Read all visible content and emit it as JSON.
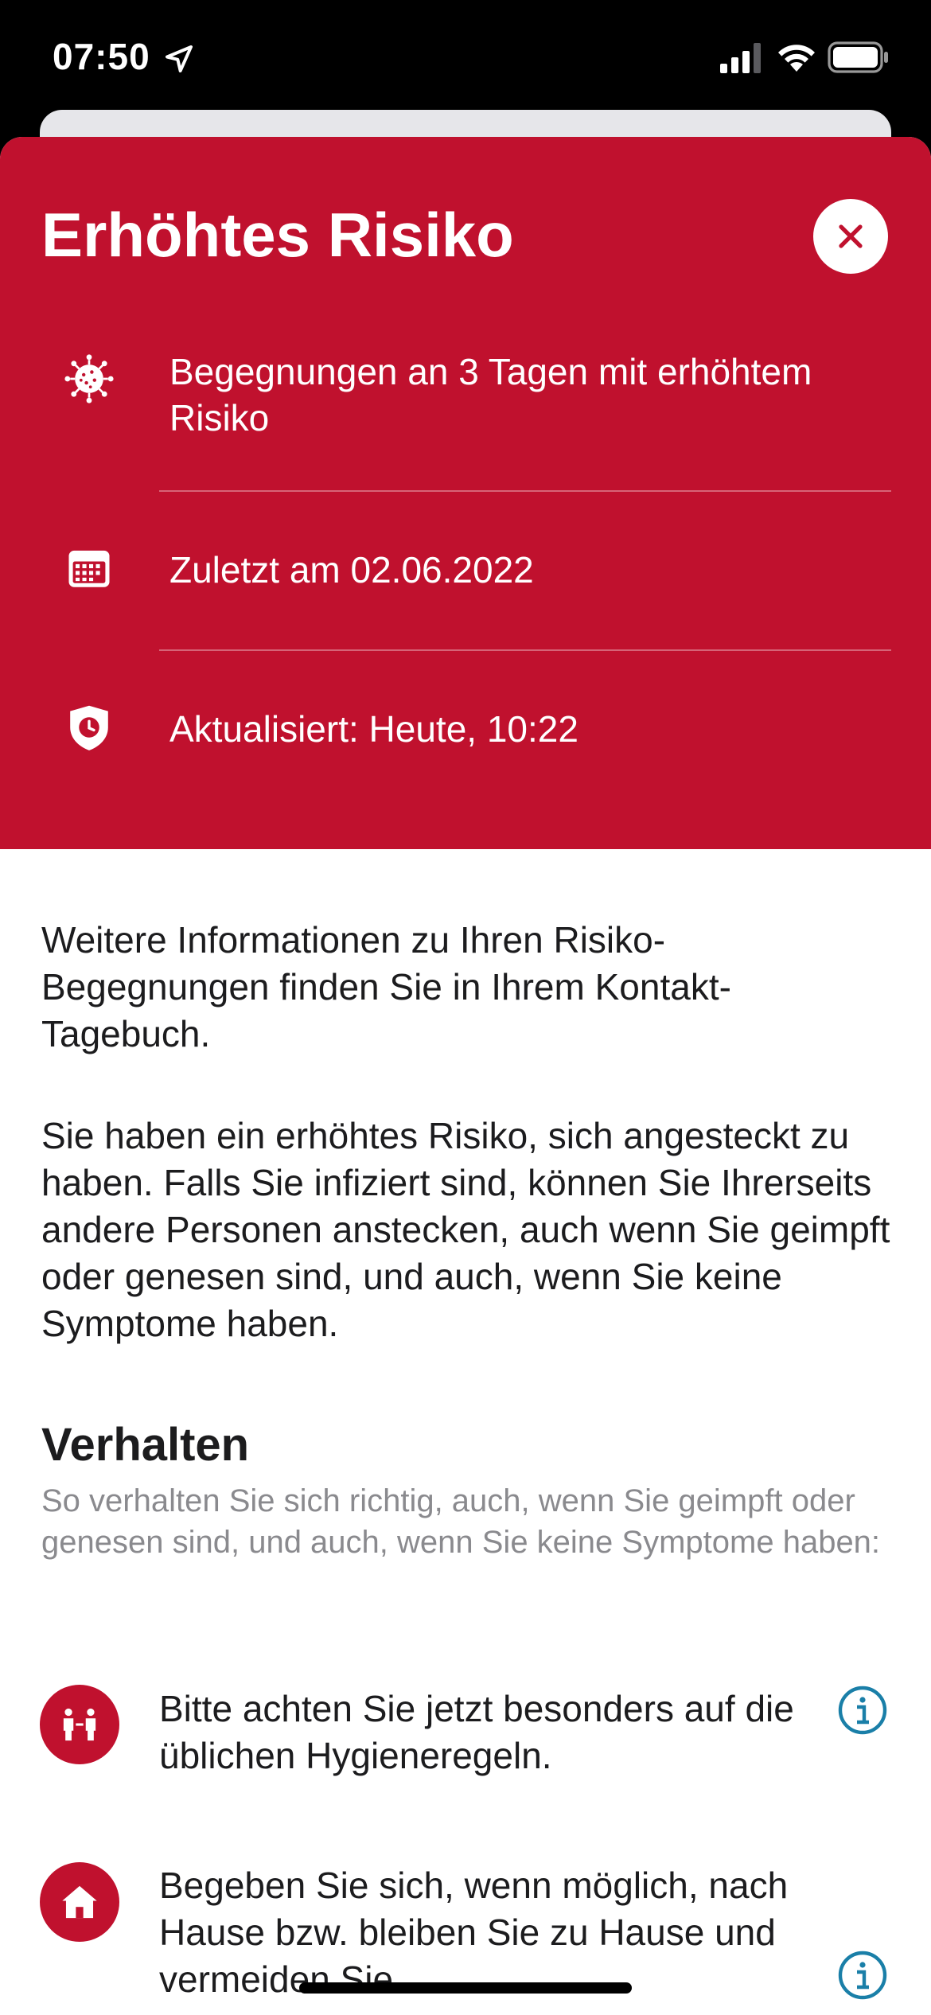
{
  "status_bar": {
    "time": "07:50"
  },
  "risk_card": {
    "title": "Erhöhtes Risiko",
    "color": "#c0112e",
    "rows": [
      {
        "icon": "virus-icon",
        "text": "Begegnungen an 3 Tagen mit erhöhtem Risiko"
      },
      {
        "icon": "calendar-icon",
        "text": "Zuletzt am 02.06.2022"
      },
      {
        "icon": "shield-clock-icon",
        "text": "Aktualisiert: Heute, 10:22"
      }
    ]
  },
  "content": {
    "paragraph1": "Weitere Informationen zu Ihren Risiko-Begegnungen finden Sie in Ihrem Kontakt-Tagebuch.",
    "paragraph2": "Sie haben ein erhöhtes Risiko, sich angesteckt zu haben. Falls Sie infiziert sind, können Sie Ihrerseits andere Personen anstecken, auch wenn Sie geimpft oder genesen sind, und auch, wenn Sie keine Symptome haben.",
    "section_title": "Verhalten",
    "section_subtitle": "So verhalten Sie sich richtig, auch, wenn Sie geimpft oder genesen sind, und auch, wenn Sie keine Symptome haben:",
    "items": [
      {
        "icon": "distance-people-icon",
        "text": "Bitte achten Sie jetzt besonders auf die üblichen Hygieneregeln."
      },
      {
        "icon": "home-icon",
        "text": "Begeben Sie sich, wenn möglich, nach Hause bzw. bleiben Sie zu Hause und vermeiden Sie"
      }
    ]
  },
  "accent_info_color": "#1a7fa8"
}
